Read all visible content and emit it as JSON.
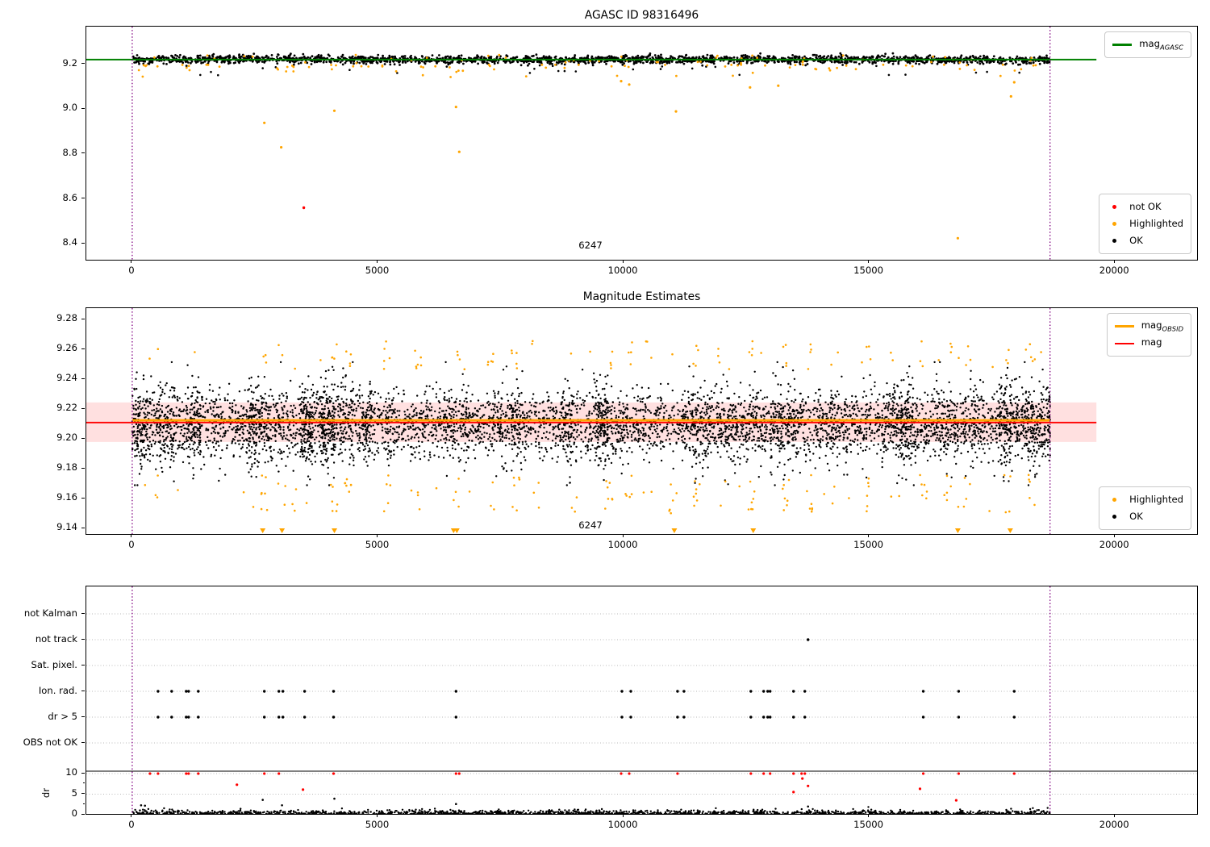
{
  "colors": {
    "ok": "#000000",
    "highlighted": "#ffa500",
    "not_ok": "#ff0000",
    "mag_agasc": "#008000",
    "mag_line": "#ff0000",
    "mag_obsid": "#ffa500",
    "mag_err_fill": "rgba(255,0,0,0.12)",
    "vline": "#800080",
    "grid": "#b9b9b9",
    "cap_line": "#000000"
  },
  "chart_data": [
    {
      "type": "scatter",
      "title": "AGASC ID 98316496",
      "xlim": [
        -934,
        21672
      ],
      "ylim": [
        8.329,
        9.368
      ],
      "xticks": [
        0,
        5000,
        10000,
        15000,
        20000
      ],
      "xtick_labels": [
        "0",
        "5000",
        "10000",
        "15000",
        "20000"
      ],
      "yticks": [
        8.4,
        8.6,
        8.8,
        9.0,
        9.2
      ],
      "ytick_labels": [
        "8.4",
        "8.6",
        "8.8",
        "9.0",
        "9.2"
      ],
      "mag_agasc": 9.221,
      "line_x_end": 19623,
      "obs_x_range": [
        0,
        18680
      ],
      "vlines": [
        0,
        18680
      ],
      "annotation": "6247",
      "legend_line": {
        "label_main": "mag",
        "label_sub": "AGASC",
        "color": "#008000"
      },
      "legend_markers": [
        {
          "label": "not OK",
          "color": "#ff0000"
        },
        {
          "label": "Highlighted",
          "color": "#ffa500"
        },
        {
          "label": "OK",
          "color": "#000000"
        }
      ],
      "scatter": {
        "ok_band": {
          "n": 2200,
          "mean": 9.221,
          "sigma": 0.009,
          "clip": [
            9.193,
            9.249
          ]
        },
        "ok_low": {
          "n": 28,
          "min": 9.15,
          "max": 9.195
        },
        "hl_low": {
          "n": 85,
          "base": 9.198,
          "spread": 0.055
        },
        "hl_mid": {
          "n": 45,
          "min": 9.205,
          "max": 9.245
        },
        "hl_outliers": [
          [
            2689,
            8.939
          ],
          [
            3033,
            8.83
          ],
          [
            4115,
            8.993
          ],
          [
            6590,
            9.01
          ],
          [
            6656,
            8.81
          ],
          [
            9951,
            9.125
          ],
          [
            10115,
            9.11
          ],
          [
            11066,
            8.99
          ],
          [
            12574,
            9.097
          ],
          [
            13148,
            9.105
          ],
          [
            16803,
            8.425
          ],
          [
            17885,
            9.057
          ],
          [
            17950,
            9.12
          ]
        ],
        "notok_outliers": [
          [
            3492,
            8.561
          ]
        ]
      }
    },
    {
      "type": "scatter",
      "title": "Magnitude Estimates",
      "xlim": [
        -934,
        21672
      ],
      "ylim": [
        9.1363,
        9.2877
      ],
      "xticks": [
        0,
        5000,
        10000,
        15000,
        20000
      ],
      "xtick_labels": [
        "0",
        "5000",
        "10000",
        "15000",
        "20000"
      ],
      "yticks": [
        9.14,
        9.16,
        9.18,
        9.2,
        9.22,
        9.24,
        9.26,
        9.28
      ],
      "ytick_labels": [
        "9.14",
        "9.16",
        "9.18",
        "9.20",
        "9.22",
        "9.24",
        "9.26",
        "9.28"
      ],
      "mag": 9.211,
      "mag_err": [
        9.198,
        9.2245
      ],
      "mag_obsid_y": 9.2125,
      "line_x_end": 19623,
      "obs_x_range": [
        0,
        18680
      ],
      "vlines": [
        0,
        18680
      ],
      "annotation": "6247",
      "legend_lines": [
        {
          "label_main": "mag",
          "label_sub": "OBSID",
          "color": "#ffa500"
        },
        {
          "label_main": "mag",
          "label_sub": "",
          "color": "#ff0000"
        }
      ],
      "legend_markers": [
        {
          "label": "Highlighted",
          "color": "#ffa500"
        },
        {
          "label": "OK",
          "color": "#000000"
        }
      ],
      "scatter": {
        "ok_base": {
          "n": 4300,
          "mean": 9.2095,
          "sigma": 0.011,
          "clip": [
            9.169,
            9.2515
          ]
        },
        "ok_clusters": {
          "count": 70,
          "per": 28,
          "xspread": 260,
          "sigma": 0.0155
        },
        "hl_cluster_x": [
          500,
          2700,
          3050,
          4100,
          4400,
          5200,
          5800,
          6600,
          7300,
          7800,
          8200,
          9000,
          9700,
          10100,
          10500,
          11000,
          11500,
          12000,
          12600,
          13300,
          13800,
          14300,
          15000,
          15400,
          16100,
          16600,
          17000,
          17800,
          18300
        ],
        "hl_low_range": [
          9.15,
          9.176
        ],
        "hl_high_range": [
          9.246,
          9.266
        ],
        "clipped_low_x": [
          2656,
          3049,
          4115,
          6541,
          6607,
          11033,
          12639,
          16803,
          17869
        ]
      }
    },
    {
      "type": "flags",
      "flag_rows": [
        "not Kalman",
        "not track",
        "Sat. pixel.",
        "Ion. rad.",
        "dr > 5",
        "OBS not OK"
      ],
      "xlim": [
        -934,
        21672
      ],
      "xticks": [
        0,
        5000,
        10000,
        15000,
        20000
      ],
      "xtick_labels": [
        "0",
        "5000",
        "10000",
        "15000",
        "20000"
      ],
      "dr_label": "dr",
      "dr_ticks": [
        10,
        5,
        0
      ],
      "dr_tick_labels": [
        "10",
        "5",
        "0"
      ],
      "dr_minor_ticks": [
        7.5,
        2.5
      ],
      "flag_x": [
        525,
        803,
        1098,
        1148,
        1344,
        2689,
        2984,
        3066,
        3508,
        4098,
        6590,
        9967,
        10148,
        11098,
        11230,
        12590,
        12852,
        12934,
        12983,
        13459,
        13689,
        16098,
        16820,
        17951
      ],
      "flag_point_rows": [
        "Ion. rad.",
        "dr > 5"
      ],
      "not_track_x": [
        13754
      ],
      "dr_red_at10_x": [
        361,
        525,
        1098,
        1148,
        1344,
        2689,
        2984,
        4098,
        6590,
        6656,
        9951,
        10115,
        11098,
        12590,
        12852,
        12983,
        13459,
        13623,
        13689,
        16098,
        16820,
        17951
      ],
      "dr_red_below": [
        [
          2131,
          7.3
        ],
        [
          3475,
          6.1
        ],
        [
          13459,
          5.5
        ],
        [
          13639,
          8.8
        ],
        [
          13754,
          7.0
        ],
        [
          16033,
          6.3
        ],
        [
          16770,
          3.5
        ]
      ],
      "dr_black_spikes": [
        [
          180,
          2.3
        ],
        [
          260,
          2.2
        ],
        [
          2656,
          3.6
        ],
        [
          3049,
          2.3
        ],
        [
          4115,
          3.9
        ],
        [
          6590,
          2.6
        ],
        [
          13754,
          2.0
        ]
      ],
      "dr_band": {
        "n": 1700,
        "sigma": 0.5,
        "offset": 0.03,
        "clip": 2.0
      },
      "dr_cap": 10.6,
      "vlines": [
        0,
        18680
      ]
    }
  ]
}
